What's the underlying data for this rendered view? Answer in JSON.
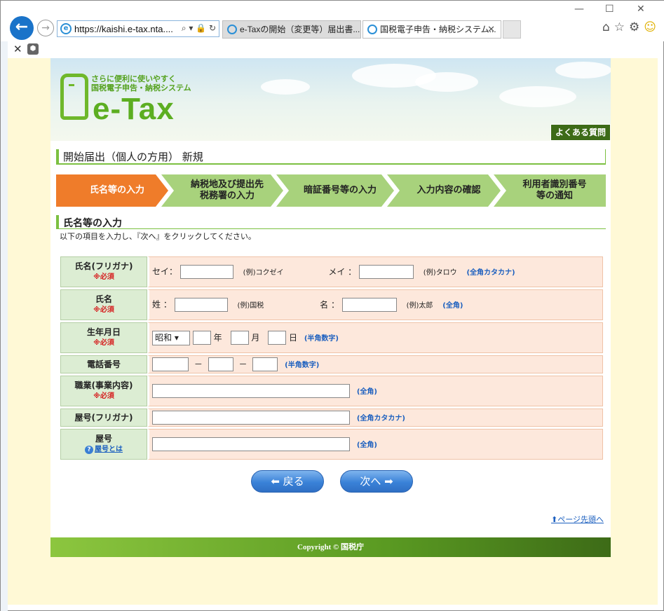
{
  "browser": {
    "url": "https://kaishi.e-tax.nta....",
    "address_tools": "⌕ ▾ 🔒 ↻",
    "tabs": [
      {
        "label": "e-Taxの開始（変更等）届出書...",
        "active": false
      },
      {
        "label": "国税電子申告・納税システム...",
        "active": true
      }
    ],
    "tab_close": "✕",
    "window_controls": {
      "minimize": "—",
      "maximize": "☐",
      "close": "✕"
    },
    "toolbar_icons": [
      "home-icon",
      "star-icon",
      "gear-icon",
      "smiley-icon"
    ],
    "cmdbar_close": "✕"
  },
  "site": {
    "logo_tagline_1": "さらに便利に使いやすく",
    "logo_tagline_2": "国税電子申告・納税システム",
    "logo_name": "e-Tax",
    "faq_link": "よくある質問",
    "page_title": "開始届出（個人の方用）  新規",
    "steps": [
      {
        "label": "氏名等の入力",
        "current": true
      },
      {
        "label": "納税地及び提出先 税務署の入力",
        "current": false
      },
      {
        "label": "暗証番号等の入力",
        "current": false
      },
      {
        "label": "入力内容の確認",
        "current": false
      },
      {
        "label": "利用者識別番号 等の通知",
        "current": false
      }
    ],
    "section_title": "氏名等の入力",
    "instruction": "以下の項目を入力し、『次へ』をクリックしてください。",
    "required_mark": "※必須",
    "form": {
      "kana": {
        "label": "氏名(フリガナ)",
        "sei_label": "セイ：",
        "sei_example": "(例)コクゼイ",
        "mei_label": "メイ ：",
        "mei_example": "(例)タロウ",
        "note": "(全角カタカナ)"
      },
      "name": {
        "label": "氏名",
        "sei_label": "姓  ：",
        "sei_example": "(例)国税",
        "mei_label": "名  ：",
        "mei_example": "(例)太郎",
        "note": "(全角)"
      },
      "birth": {
        "label": "生年月日",
        "era": "昭和",
        "year_unit": "年",
        "month_unit": "月",
        "day_unit": "日",
        "note": "(半角数字)"
      },
      "phone": {
        "label": "電話番号",
        "sep": "－",
        "note": "(半角数字)"
      },
      "occupation": {
        "label": "職業(事業内容)",
        "note": "(全角)"
      },
      "trade_kana": {
        "label": "屋号(フリガナ)",
        "note": "(全角カタカナ)"
      },
      "trade": {
        "label": "屋号",
        "help": "屋号とは",
        "note": "(全角)"
      }
    },
    "back_button": "⬅ 戻る",
    "next_button": "次へ ➡",
    "page_top_link": "⬆ページ先頭へ",
    "footer": "Copyright © 国税庁"
  }
}
